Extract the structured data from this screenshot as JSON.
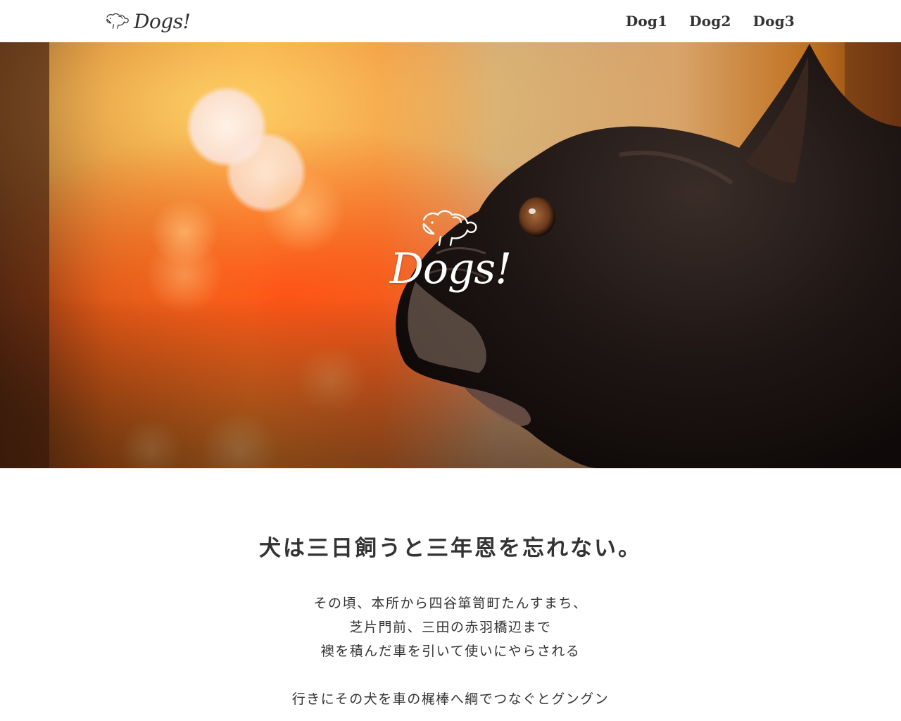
{
  "header": {
    "brand_name": "Dogs!",
    "brand_icon": "dog-logo-icon",
    "nav": [
      {
        "label": "Dog1"
      },
      {
        "label": "Dog2"
      },
      {
        "label": "Dog3"
      }
    ]
  },
  "hero": {
    "logo_text": "Dogs!",
    "logo_icon": "dog-logo-icon",
    "image_subject": "black french bulldog profile with orange bokeh background"
  },
  "content": {
    "headline": "犬は三日飼うと三年恩を忘れない。",
    "paragraph_1": [
      "その頃、本所から四谷箪笥町たんすまち、",
      "芝片門前、三田の赤羽橋辺まで",
      "襖を積んだ車を引いて使いにやらされる"
    ],
    "paragraph_2": [
      "行きにその犬を車の梶棒へ綱でつなぐとグングン"
    ]
  },
  "colors": {
    "text": "#333333",
    "header_bg": "#ffffff",
    "hero_logo": "#ffffff"
  }
}
